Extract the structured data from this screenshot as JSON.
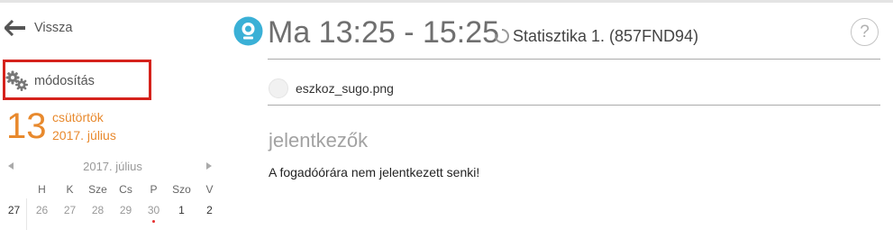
{
  "sidebar": {
    "back_label": "Vissza",
    "edit_label": "módosítás",
    "date": {
      "day_number": "13",
      "weekday": "csütörtök",
      "month_year": "2017. július"
    },
    "calendar": {
      "title": "2017. július",
      "weekdays": [
        "H",
        "K",
        "Sze",
        "Cs",
        "P",
        "Szo",
        "V"
      ],
      "days": [
        "27",
        "26",
        "27",
        "28",
        "29",
        "30",
        "1",
        "2"
      ],
      "selected_marker_color": "#e53030"
    }
  },
  "main": {
    "time_title": "Ma 13:25 - 15:25",
    "subject": "Statisztika 1. (857FND94)",
    "help_label": "?",
    "attachment": "eszkoz_sugo.png",
    "section_title": "jelentkezők",
    "section_message": "A fogadóórára nem jelentkezett senki!",
    "accent_color": "#3ab0d6"
  },
  "colors": {
    "highlight_box": "#d5221c",
    "date_accent": "#e8892d"
  }
}
